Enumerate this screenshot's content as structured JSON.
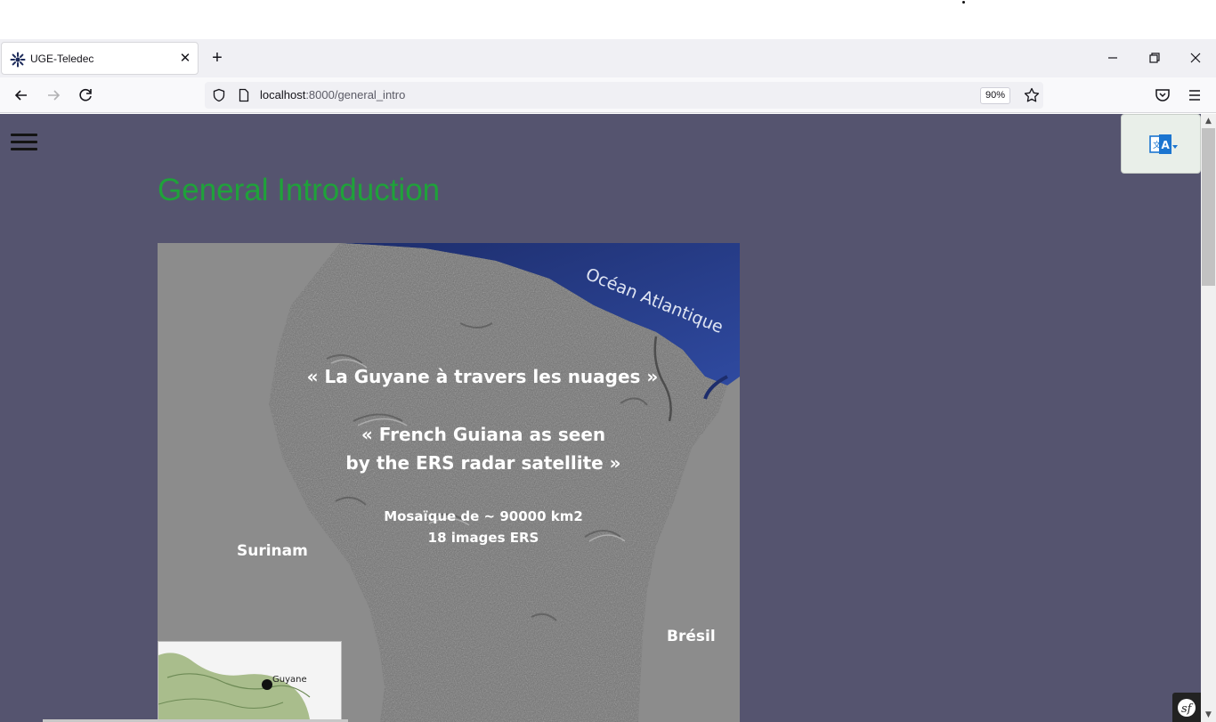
{
  "browser": {
    "tab": {
      "title": "UGE-Teledec",
      "favicon": "starburst-favicon-icon",
      "close_icon": "close-icon"
    },
    "new_tab_icon": "plus-icon",
    "window_controls": {
      "minimize": "minimize-icon",
      "restore": "restore-icon",
      "close": "close-icon"
    },
    "nav": {
      "back": "back-arrow-icon",
      "forward": "forward-arrow-icon",
      "reload": "reload-icon"
    },
    "url": {
      "host": "localhost",
      "path": ":8000/general_intro"
    },
    "zoom": "90%",
    "toolbar_icons": [
      "shield-icon",
      "page-icon",
      "star-icon",
      "pocket-icon",
      "menu-icon"
    ]
  },
  "page": {
    "title": "General Introduction",
    "menu_icon": "hamburger-menu-icon",
    "language_icon": "translate-icon",
    "background": "#55546f",
    "title_color": "#1fa23a",
    "figure": {
      "ocean_label": "Océan Atlantique",
      "quote_fr": "« La Guyane à travers les nuages »",
      "quote_en_line1": "« French Guiana as seen",
      "quote_en_line2": "by the ERS radar satellite »",
      "mosaic_line1": "Mosaïque  de ~ 90000 km2",
      "mosaic_line2": "18 images ERS",
      "label_west": "Surinam",
      "label_east": "Brésil",
      "inset_label": "Guyane"
    }
  }
}
